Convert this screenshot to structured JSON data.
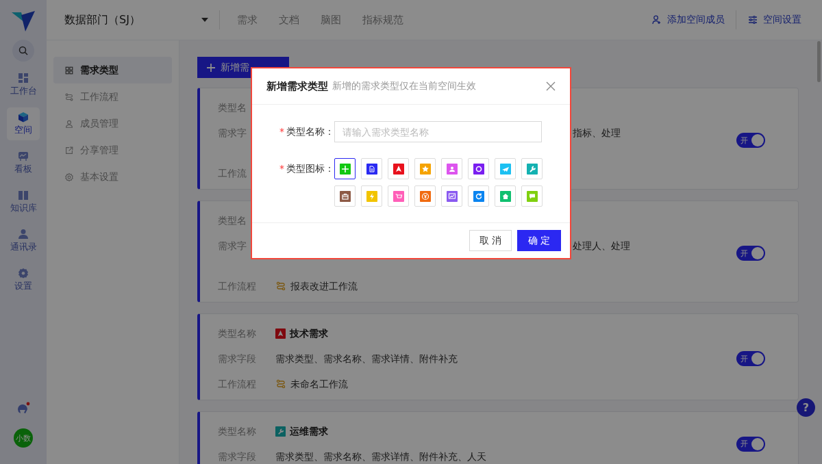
{
  "rail": {
    "items": [
      {
        "label": "工作台",
        "kind": "grid",
        "selected": false
      },
      {
        "label": "空间",
        "kind": "cube",
        "selected": true
      },
      {
        "label": "看板",
        "kind": "board",
        "selected": false
      },
      {
        "label": "知识库",
        "kind": "book",
        "selected": false
      },
      {
        "label": "通讯录",
        "kind": "person",
        "selected": false
      },
      {
        "label": "设置",
        "kind": "gear",
        "selected": false
      }
    ],
    "notification": true,
    "avatar": "小数"
  },
  "header": {
    "space": "数据部门（SJ）",
    "tabs": [
      {
        "label": "需求",
        "selected": false
      },
      {
        "label": "文档",
        "selected": false
      },
      {
        "label": "脑图",
        "selected": false
      },
      {
        "label": "指标规范",
        "selected": false
      }
    ],
    "actions": [
      {
        "label": "添加空间成员",
        "kind": "add-member"
      },
      {
        "label": "空间设置",
        "kind": "sliders"
      }
    ]
  },
  "sidebar": {
    "items": [
      {
        "label": "需求类型",
        "kind": "grid",
        "selected": true
      },
      {
        "label": "工作流程",
        "kind": "flow",
        "selected": false
      },
      {
        "label": "成员管理",
        "kind": "person",
        "selected": false
      },
      {
        "label": "分享管理",
        "kind": "share",
        "selected": false
      },
      {
        "label": "基本设置",
        "kind": "gear",
        "selected": false
      }
    ]
  },
  "toolbar": {
    "add_button": "新增需"
  },
  "cards": [
    {
      "name_label": "类型名",
      "fields_label": "需求字",
      "fields": {
        "line_1_end": "指标、处理"
      },
      "workflow_label": "工作流",
      "on": true,
      "toggle_label": "开"
    },
    {
      "name_label": "类型名",
      "fields_label": "需求字",
      "fields": {
        "line_1_end": "处理人、处理"
      },
      "workflow_label": "工作流程",
      "workflow": "报表改进工作流",
      "on": true,
      "toggle_label": "开"
    },
    {
      "name_label": "类型名称",
      "name": "技术需求",
      "name_icon": {
        "kind": "a"
      },
      "fields_label": "需求字段",
      "fields": {
        "line_1": "需求类型、需求名称、需求详情、附件补充"
      },
      "workflow_label": "工作流程",
      "workflow": "未命名工作流",
      "on": true,
      "toggle_label": "开"
    },
    {
      "name_label": "类型名称",
      "name": "运维需求",
      "name_icon": {
        "kind": "wrench"
      },
      "fields_label": "需求字段",
      "fields": {
        "line_1": "需求类型、需求名称、需求详情、附件补充、人天"
      },
      "on": true,
      "toggle_label": "开"
    }
  ],
  "dialog": {
    "title": "新增需求类型",
    "subtitle": "新增的需求类型仅在当前空间生效",
    "required_mark": "*",
    "name_label": "类型名称：",
    "name_placeholder": "请输入需求类型名称",
    "icon_label": "类型图标：",
    "icons": [
      {
        "kind": "plus",
        "color": "#12c812",
        "selected": true
      },
      {
        "kind": "doc",
        "color": "#2a2af2",
        "selected": false
      },
      {
        "kind": "a",
        "color": "#e8121d",
        "selected": false
      },
      {
        "kind": "star",
        "color": "#f5a300",
        "selected": false
      },
      {
        "kind": "person",
        "color": "#dd55ee",
        "selected": false
      },
      {
        "kind": "ring",
        "color": "#7a1ff0",
        "selected": false
      },
      {
        "kind": "plane",
        "color": "#1cc0f2",
        "selected": false
      },
      {
        "kind": "wrench",
        "color": "#14b1b1",
        "selected": false
      },
      {
        "kind": "case",
        "color": "#8d5a45",
        "selected": false
      },
      {
        "kind": "bolt",
        "color": "#f2c400",
        "selected": false
      },
      {
        "kind": "cart",
        "color": "#ff5fb8",
        "selected": false
      },
      {
        "kind": "yen",
        "color": "#f06a0f",
        "selected": false
      },
      {
        "kind": "chart",
        "color": "#8a5af0",
        "selected": false
      },
      {
        "kind": "refresh",
        "color": "#0a84f0",
        "selected": false
      },
      {
        "kind": "home",
        "color": "#10c070",
        "selected": false
      },
      {
        "kind": "chat",
        "color": "#80d010",
        "selected": false
      }
    ],
    "cancel": "取 消",
    "confirm": "确 定"
  },
  "help_button": "?"
}
